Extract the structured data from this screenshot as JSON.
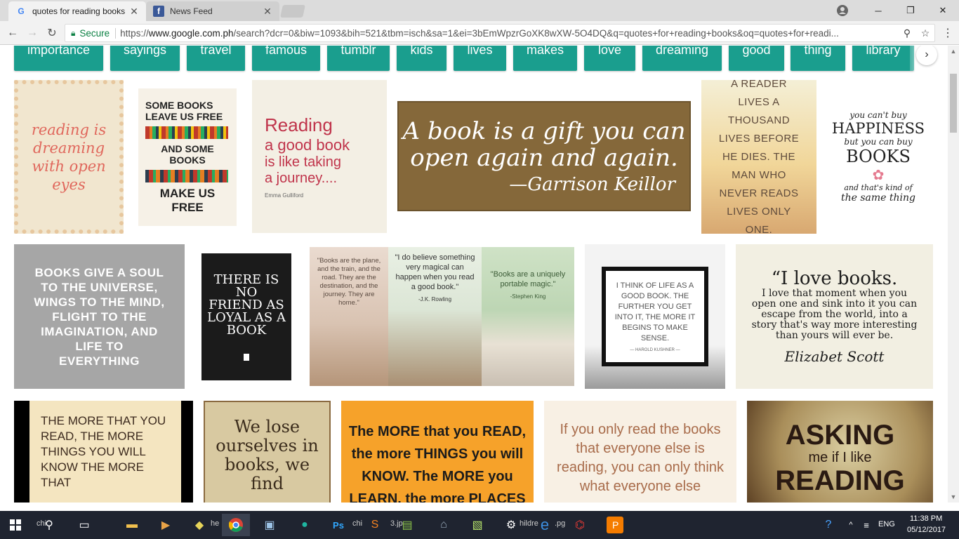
{
  "browser": {
    "tabs": [
      {
        "title": "quotes for reading books",
        "active": true
      },
      {
        "title": "News Feed",
        "active": false
      }
    ],
    "security_label": "Secure",
    "url_scheme": "https://",
    "url_host": "www.google.com.ph",
    "url_path": "/search?dcr=0&biw=1093&bih=521&tbm=isch&sa=1&ei=3bEmWpzrGoXK8wXW-5O4DQ&q=quotes+for+reading+books&oq=quotes+for+readi..."
  },
  "chips": [
    "importance",
    "sayings",
    "travel",
    "famous",
    "tumblr",
    "kids",
    "lives",
    "makes",
    "love",
    "dreaming",
    "good",
    "thing",
    "library"
  ],
  "tiles": {
    "t1": {
      "text": "reading is dreaming with open eyes"
    },
    "t2": {
      "line1": "SOME BOOKS",
      "line2": "LEAVE US FREE",
      "line3": "AND SOME BOOKS",
      "line4": "MAKE US FREE"
    },
    "t3": {
      "word1": "Reading",
      "word2": "a good book",
      "word3": "is like taking",
      "word4": "a journey....",
      "author": "Emma Gulliford"
    },
    "t4": {
      "line1": "A book is a gift you can",
      "line2": "open again and again.",
      "author": "—Garrison Keillor"
    },
    "t5": {
      "text": "A READER LIVES A THOUSAND LIVES BEFORE HE DIES. THE MAN WHO NEVER READS LIVES ONLY ONE."
    },
    "t6": {
      "line1": "you can't buy",
      "line2": "HAPPINESS",
      "line3": "but you can buy",
      "line4": "BOOKS",
      "line5": "and that's kind of",
      "line6": "the same thing"
    },
    "t7": {
      "text": "BOOKS GIVE A SOUL TO THE UNIVERSE, WINGS TO THE MIND, FLIGHT TO THE IMAGINATION, AND LIFE TO EVERYTHING"
    },
    "t8": {
      "text": "THERE IS NO FRIEND AS LOYAL AS A BOOK"
    },
    "t9": {
      "q1": "\"Books are the plane, and the train, and the road. They are the destination, and the journey. They are home.\"",
      "q2": "\"I do believe something very magical can happen when you read a good book.\"",
      "a2": "-J.K. Rowling",
      "q3": "\"Books are a uniquely portable magic.\"",
      "a3": "-Stephen King"
    },
    "t10": {
      "text": "I THINK OF LIFE AS A GOOD BOOK. THE FURTHER YOU GET INTO IT, THE MORE IT BEGINS TO MAKE SENSE.",
      "author": "— HAROLD KUSHNER —"
    },
    "t11": {
      "head": "“I love books.",
      "body": "I love that moment when you open one and sink into it you can escape from the world, into a story that's way more interesting than yours will ever be.",
      "author": "Elizabet Scott"
    },
    "t12": {
      "text": "THE MORE THAT YOU READ, THE MORE THINGS YOU WILL KNOW THE MORE THAT"
    },
    "t13": {
      "text": "We lose ourselves in books, we find"
    },
    "t14": {
      "text": "The MORE that you READ, the more THINGS you will KNOW. The MORE you LEARN, the more PLACES you'll GO!"
    },
    "t15": {
      "text": "If you only read the books that everyone else is reading, you can only think what everyone else"
    },
    "t16": {
      "line1": "ASKING",
      "line2": "me if I like",
      "line3": "READING"
    }
  },
  "taskbar": {
    "labels": [
      "chi",
      "5",
      "he",
      "chi",
      "3.jp",
      "hildre",
      ".pg"
    ],
    "lang": "ENG",
    "time": "11:38 PM",
    "date": "05/12/2017"
  }
}
